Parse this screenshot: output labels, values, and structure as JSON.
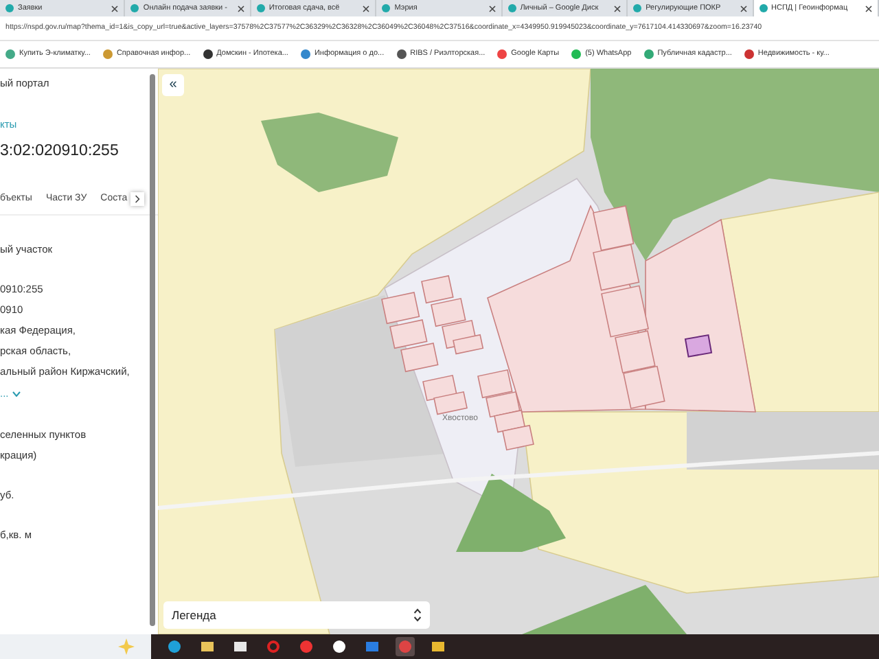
{
  "browser_tabs": [
    {
      "title": "Заявки",
      "selected": false
    },
    {
      "title": "Онлайн подача заявки -",
      "selected": false
    },
    {
      "title": "Итоговая сдача, всё",
      "selected": false
    },
    {
      "title": "Мэрия",
      "selected": false
    },
    {
      "title": "Личный – Google Диск",
      "selected": false
    },
    {
      "title": "Регулирующие ПОКР",
      "selected": false
    },
    {
      "title": "НСПД | Геоинформац",
      "selected": true
    }
  ],
  "address_bar": {
    "url": "https://nspd.gov.ru/map?thema_id=1&is_copy_url=true&active_layers=37578%2C37577%2C36329%2C36328%2C36049%2C36048%2C37516&coordinate_x=4349950.919945023&coordinate_y=7617104.414330697&zoom=16.23740"
  },
  "bookmarks": [
    "Купить Э-климатку...",
    "Справочная инфор...",
    "Домскин - Ипотека...",
    "Информация о до...",
    "RIBS / Риэлторская...",
    "Google Карты",
    "(5) WhatsApp",
    "Публичная кадастр...",
    "Недвижимость - ку..."
  ],
  "side_panel": {
    "sections": [
      [
        {
          "kind": "text",
          "text": "ый портал"
        }
      ],
      [
        {
          "kind": "link",
          "text": "кты"
        },
        {
          "kind": "heading",
          "text": "3:02:020910:255"
        }
      ],
      [
        {
          "kind": "tabs",
          "items": [
            "бъекты",
            "Части ЗУ",
            "Соста"
          ]
        }
      ],
      [
        {
          "kind": "text",
          "text": "ый участок"
        }
      ],
      [
        {
          "kind": "text",
          "text": "0910:255"
        },
        {
          "kind": "text",
          "text": "0910"
        },
        {
          "kind": "text",
          "text": "кая Федерация,"
        },
        {
          "kind": "text",
          "text": "рская область,"
        },
        {
          "kind": "text",
          "text": "альный район Киржачский,"
        },
        {
          "kind": "more",
          "text": "..."
        }
      ],
      [
        {
          "kind": "text",
          "text": "селенных пунктов"
        },
        {
          "kind": "text",
          "text": "крация)"
        }
      ],
      [
        {
          "kind": "text",
          "text": "уб."
        }
      ],
      [
        {
          "kind": "text",
          "text": "б,кв. м"
        }
      ]
    ]
  },
  "map": {
    "collapse_button": "«",
    "place_label": "Хвостово",
    "legend": "Легенда"
  },
  "taskbar": {
    "apps": [
      {
        "kind": "edge",
        "active": false
      },
      {
        "kind": "folder",
        "active": false
      },
      {
        "kind": "store",
        "active": false
      },
      {
        "kind": "opera",
        "active": false
      },
      {
        "kind": "yandex",
        "active": false
      },
      {
        "kind": "ybrowser",
        "active": false
      },
      {
        "kind": "mail",
        "active": false
      },
      {
        "kind": "chrome",
        "active": true
      },
      {
        "kind": "explorer",
        "active": false
      }
    ]
  }
}
